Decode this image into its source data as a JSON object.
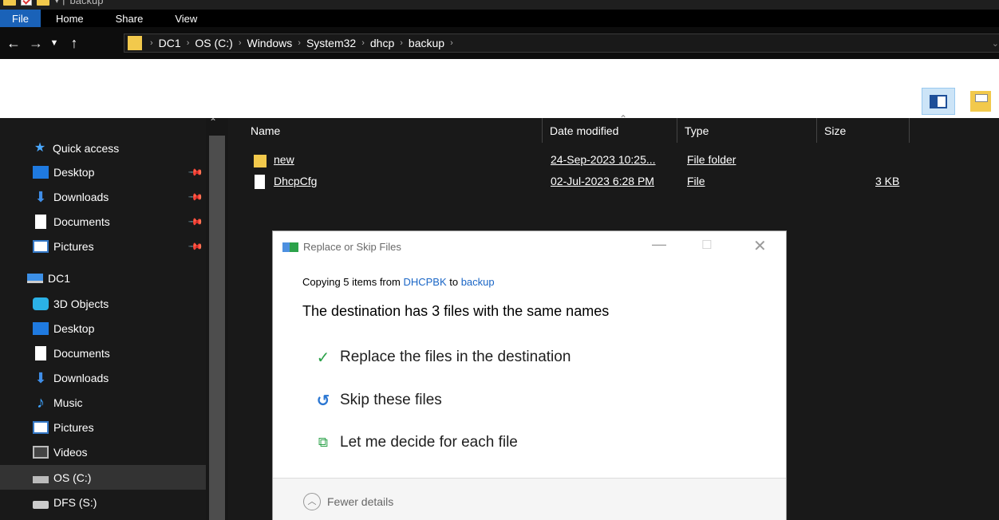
{
  "titlebar": {
    "title": "backup"
  },
  "ribbon": {
    "tabs": [
      "File",
      "Home",
      "Share",
      "View"
    ]
  },
  "address": {
    "crumbs": [
      "DC1",
      "OS (C:)",
      "Windows",
      "System32",
      "dhcp",
      "backup"
    ]
  },
  "nav": {
    "quick_access": "Quick access",
    "quick_items": [
      "Desktop",
      "Downloads",
      "Documents",
      "Pictures"
    ],
    "pc": "DC1",
    "pc_items": [
      "3D Objects",
      "Desktop",
      "Documents",
      "Downloads",
      "Music",
      "Pictures",
      "Videos",
      "OS (C:)",
      "DFS (S:)"
    ]
  },
  "columns": {
    "name": "Name",
    "date": "Date modified",
    "type": "Type",
    "size": "Size"
  },
  "files": [
    {
      "name": "new",
      "date": "24-Sep-2023 10:25...",
      "type": "File folder",
      "size": ""
    },
    {
      "name": "DhcpCfg",
      "date": "02-Jul-2023 6:28 PM",
      "type": "File",
      "size": "3 KB"
    }
  ],
  "dialog": {
    "title": "Replace or Skip Files",
    "copy_prefix": "Copying 5 items from ",
    "source": "DHCPBK",
    "copy_mid": " to ",
    "dest": "backup",
    "heading": "The destination has 3 files with the same names",
    "replace": "Replace the files in the destination",
    "skip": "Skip these files",
    "decide": "Let me decide for each file",
    "fewer": "Fewer details"
  }
}
